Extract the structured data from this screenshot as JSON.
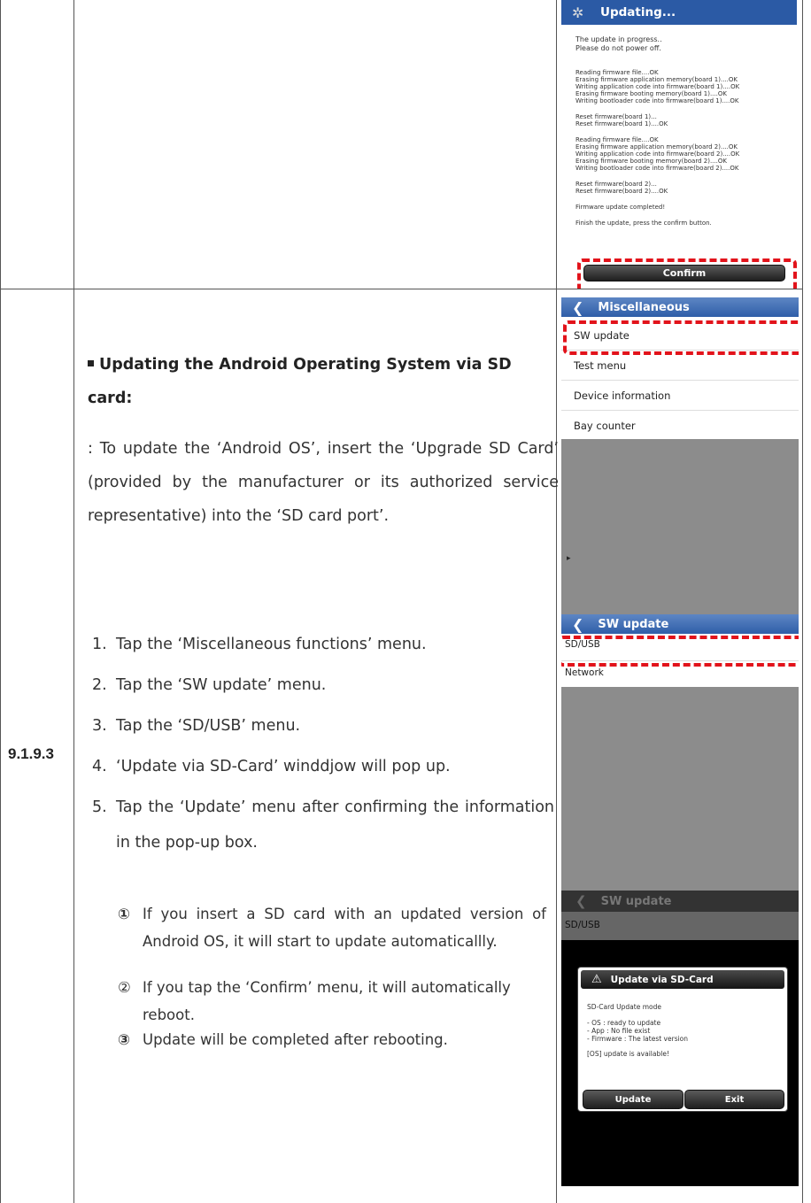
{
  "section": {
    "number": "9.1.9.3",
    "heading": "Updating the Android Operating System via SD card:",
    "intro": ": To update the ‘Android OS’, insert the ‘Upgrade SD Card’ (provided by the manufacturer or its authorized service representative) into the ‘SD card port’.",
    "steps": [
      {
        "num": "1.",
        "text": "Tap the ‘Miscellaneous functions’ menu."
      },
      {
        "num": "2.",
        "text": "Tap the ‘SW update’ menu."
      },
      {
        "num": "3.",
        "text": "Tap the ‘SD/USB’ menu."
      },
      {
        "num": "4.",
        "text": "‘Update via SD-Card’ winddjow will pop up."
      },
      {
        "num": "5.",
        "text": "Tap the ‘Update’ menu after confirming the information in the pop-up box."
      }
    ],
    "substeps": [
      {
        "mark": "①",
        "text": "If you insert a SD card with an updated version of Android OS, it will start to update automaticallly."
      },
      {
        "mark": "②",
        "text": "If you tap the ‘Confirm’ menu, it will automatically reboot."
      },
      {
        "mark": "③",
        "text": "Update will be completed after rebooting."
      }
    ]
  },
  "updating_screen": {
    "title": "Updating...",
    "icon": "gear-icon",
    "lines_top": [
      "The update in progress..",
      "Please do not power off."
    ],
    "board1": [
      "Reading firmware file....OK",
      "Erasing firmware application memory(board 1)....OK",
      "Writing application code into firmware(board 1)....OK",
      "Erasing firmware booting memory(board 1)....OK",
      "Writing bootloader code into firmware(board 1)....OK"
    ],
    "reset1": [
      "Reset firmware(board 1)...",
      "Reset firmware(board 1)....OK"
    ],
    "board2": [
      "Reading firmware file....OK",
      "Erasing firmware application memory(board 2)....OK",
      "Writing application code into firmware(board 2)....OK",
      "Erasing firmware booting memory(board 2)....OK",
      "Writing bootloader code into firmware(board 2)....OK"
    ],
    "reset2": [
      "Reset firmware(board 2)...",
      "Reset firmware(board 2)....OK"
    ],
    "completed": "Firmware update completed!",
    "finish": "Finish the update, press the confirm button.",
    "confirm_label": "Confirm"
  },
  "misc_screen": {
    "title": "Miscellaneous",
    "items": [
      "SW update",
      "Test menu",
      "Device information",
      "Bay counter"
    ]
  },
  "swupdate_screen": {
    "title": "SW update",
    "items": [
      "SD/USB",
      "Network"
    ]
  },
  "popup_screen": {
    "title": "SW update",
    "item": "SD/USB",
    "dialog_title": "Update via SD-Card",
    "mode": "SD-Card Update mode",
    "status": [
      "- OS : ready to update",
      "- App : No file exist",
      "- Firmware : The latest version"
    ],
    "available": "[OS] update is available!",
    "update_label": "Update",
    "exit_label": "Exit"
  },
  "colors": {
    "accent_red": "#e2131b",
    "titlebar_blue": "#3a67b0",
    "screen_gray": "#8c8c8c"
  }
}
